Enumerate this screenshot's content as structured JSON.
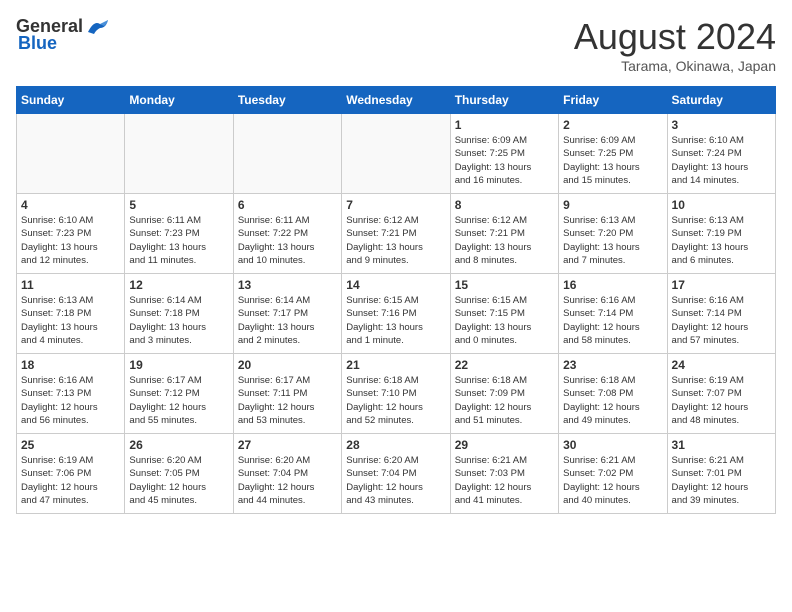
{
  "header": {
    "logo_general": "General",
    "logo_blue": "Blue",
    "month_title": "August 2024",
    "subtitle": "Tarama, Okinawa, Japan"
  },
  "weekdays": [
    "Sunday",
    "Monday",
    "Tuesday",
    "Wednesday",
    "Thursday",
    "Friday",
    "Saturday"
  ],
  "weeks": [
    [
      {
        "day": "",
        "info": ""
      },
      {
        "day": "",
        "info": ""
      },
      {
        "day": "",
        "info": ""
      },
      {
        "day": "",
        "info": ""
      },
      {
        "day": "1",
        "info": "Sunrise: 6:09 AM\nSunset: 7:25 PM\nDaylight: 13 hours\nand 16 minutes."
      },
      {
        "day": "2",
        "info": "Sunrise: 6:09 AM\nSunset: 7:25 PM\nDaylight: 13 hours\nand 15 minutes."
      },
      {
        "day": "3",
        "info": "Sunrise: 6:10 AM\nSunset: 7:24 PM\nDaylight: 13 hours\nand 14 minutes."
      }
    ],
    [
      {
        "day": "4",
        "info": "Sunrise: 6:10 AM\nSunset: 7:23 PM\nDaylight: 13 hours\nand 12 minutes."
      },
      {
        "day": "5",
        "info": "Sunrise: 6:11 AM\nSunset: 7:23 PM\nDaylight: 13 hours\nand 11 minutes."
      },
      {
        "day": "6",
        "info": "Sunrise: 6:11 AM\nSunset: 7:22 PM\nDaylight: 13 hours\nand 10 minutes."
      },
      {
        "day": "7",
        "info": "Sunrise: 6:12 AM\nSunset: 7:21 PM\nDaylight: 13 hours\nand 9 minutes."
      },
      {
        "day": "8",
        "info": "Sunrise: 6:12 AM\nSunset: 7:21 PM\nDaylight: 13 hours\nand 8 minutes."
      },
      {
        "day": "9",
        "info": "Sunrise: 6:13 AM\nSunset: 7:20 PM\nDaylight: 13 hours\nand 7 minutes."
      },
      {
        "day": "10",
        "info": "Sunrise: 6:13 AM\nSunset: 7:19 PM\nDaylight: 13 hours\nand 6 minutes."
      }
    ],
    [
      {
        "day": "11",
        "info": "Sunrise: 6:13 AM\nSunset: 7:18 PM\nDaylight: 13 hours\nand 4 minutes."
      },
      {
        "day": "12",
        "info": "Sunrise: 6:14 AM\nSunset: 7:18 PM\nDaylight: 13 hours\nand 3 minutes."
      },
      {
        "day": "13",
        "info": "Sunrise: 6:14 AM\nSunset: 7:17 PM\nDaylight: 13 hours\nand 2 minutes."
      },
      {
        "day": "14",
        "info": "Sunrise: 6:15 AM\nSunset: 7:16 PM\nDaylight: 13 hours\nand 1 minute."
      },
      {
        "day": "15",
        "info": "Sunrise: 6:15 AM\nSunset: 7:15 PM\nDaylight: 13 hours\nand 0 minutes."
      },
      {
        "day": "16",
        "info": "Sunrise: 6:16 AM\nSunset: 7:14 PM\nDaylight: 12 hours\nand 58 minutes."
      },
      {
        "day": "17",
        "info": "Sunrise: 6:16 AM\nSunset: 7:14 PM\nDaylight: 12 hours\nand 57 minutes."
      }
    ],
    [
      {
        "day": "18",
        "info": "Sunrise: 6:16 AM\nSunset: 7:13 PM\nDaylight: 12 hours\nand 56 minutes."
      },
      {
        "day": "19",
        "info": "Sunrise: 6:17 AM\nSunset: 7:12 PM\nDaylight: 12 hours\nand 55 minutes."
      },
      {
        "day": "20",
        "info": "Sunrise: 6:17 AM\nSunset: 7:11 PM\nDaylight: 12 hours\nand 53 minutes."
      },
      {
        "day": "21",
        "info": "Sunrise: 6:18 AM\nSunset: 7:10 PM\nDaylight: 12 hours\nand 52 minutes."
      },
      {
        "day": "22",
        "info": "Sunrise: 6:18 AM\nSunset: 7:09 PM\nDaylight: 12 hours\nand 51 minutes."
      },
      {
        "day": "23",
        "info": "Sunrise: 6:18 AM\nSunset: 7:08 PM\nDaylight: 12 hours\nand 49 minutes."
      },
      {
        "day": "24",
        "info": "Sunrise: 6:19 AM\nSunset: 7:07 PM\nDaylight: 12 hours\nand 48 minutes."
      }
    ],
    [
      {
        "day": "25",
        "info": "Sunrise: 6:19 AM\nSunset: 7:06 PM\nDaylight: 12 hours\nand 47 minutes."
      },
      {
        "day": "26",
        "info": "Sunrise: 6:20 AM\nSunset: 7:05 PM\nDaylight: 12 hours\nand 45 minutes."
      },
      {
        "day": "27",
        "info": "Sunrise: 6:20 AM\nSunset: 7:04 PM\nDaylight: 12 hours\nand 44 minutes."
      },
      {
        "day": "28",
        "info": "Sunrise: 6:20 AM\nSunset: 7:04 PM\nDaylight: 12 hours\nand 43 minutes."
      },
      {
        "day": "29",
        "info": "Sunrise: 6:21 AM\nSunset: 7:03 PM\nDaylight: 12 hours\nand 41 minutes."
      },
      {
        "day": "30",
        "info": "Sunrise: 6:21 AM\nSunset: 7:02 PM\nDaylight: 12 hours\nand 40 minutes."
      },
      {
        "day": "31",
        "info": "Sunrise: 6:21 AM\nSunset: 7:01 PM\nDaylight: 12 hours\nand 39 minutes."
      }
    ]
  ]
}
